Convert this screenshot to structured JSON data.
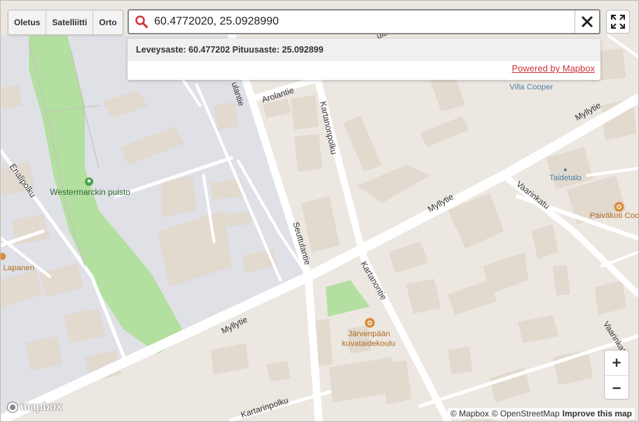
{
  "layers": [
    "Oletus",
    "Satelliitti",
    "Orto"
  ],
  "search": {
    "value": "60.4772020, 25.0928990"
  },
  "result": {
    "text": "Leveysaste: 60.477202 Pituusaste: 25.092899"
  },
  "powered_by": "Powered by Mapbox",
  "map": {
    "streets": {
      "arolantie": "Arolantie",
      "kartanonpolku": "Kartanonpolku",
      "enalipolku": "Enalipolku",
      "myllytie_ne": "Myllytie",
      "myllytie_mid": "Myllytie",
      "myllytie_sw": "Myllytie",
      "vaarinkatu": "Vaarinkatu",
      "vaarinkatu_se": "Vaarinkatu",
      "seuttulantie": "Seuttulantie",
      "kartanontie": "Kartanontie",
      "north_road": "ulantie",
      "top_road": "ulantie",
      "bottom_road": "Kartarinpolku"
    },
    "places": {
      "park": "Westermarckin puisto",
      "villa": "Villa Cooper",
      "taidetalo": "Taidetalo",
      "paivakoti": "Päiväkoti Coo",
      "lapanen": "Lapanen",
      "school_line1": "Järvenpään",
      "school_line2": "kuvataidekoulu"
    }
  },
  "zoom": {
    "in": "+",
    "out": "−"
  },
  "attribution": {
    "mapbox": "© Mapbox",
    "osm": "© OpenStreetMap",
    "improve": "Improve this map"
  },
  "logo": {
    "text": "mapbox"
  },
  "colors": {
    "accent": "#d0323a",
    "park": "#b3dfa0",
    "land": "#ece7e1",
    "residential": "#dfe1e7",
    "building": "#e2d9cf"
  }
}
